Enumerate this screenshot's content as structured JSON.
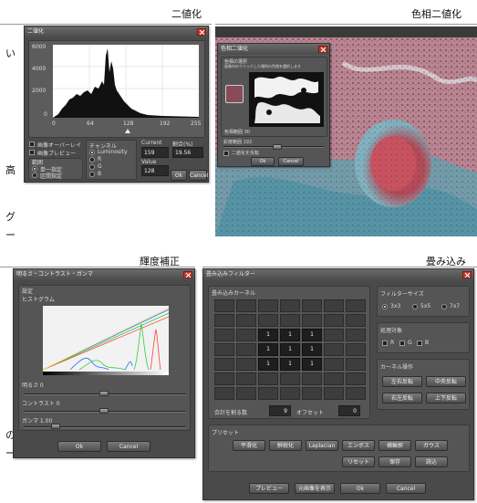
{
  "headings": {
    "binarize": "二値化",
    "hue_binarize": "色相二値化",
    "brightness": "輝度補正",
    "convolution": "畳み込み"
  },
  "side_fragments": [
    "い",
    "高",
    "グ",
    "ー",
    "の",
    "ー"
  ],
  "binarize": {
    "title": "二値化",
    "y_ticks": [
      "6000",
      "4000",
      "2000",
      "0"
    ],
    "x_ticks": [
      "0",
      "64",
      "128",
      "192",
      "255"
    ],
    "overlay_label": "画像オーバーレイ",
    "preview_label": "画像プレビュー",
    "region_label": "範囲",
    "region_options": [
      "単一指定",
      "区間指定"
    ],
    "channel_label": "チャンネル",
    "channel_options": [
      "Luminosity",
      "R",
      "G",
      "B"
    ],
    "current_label": "Current",
    "ratio_label": "割合(%)",
    "current_value": "159",
    "ratio_value": "19.56",
    "value_label": "Value",
    "value": "128",
    "ok": "Ok",
    "cancel": "Cancel"
  },
  "hue": {
    "title": "色相二値化",
    "inner_label_1": "色相の選択",
    "inner_label_2": "画像内のクリックした場所の色相を選択します",
    "tolerance_label": "色相範囲 30",
    "hue_range_label": "彩度範囲 192",
    "invert_label": "二値化を反転",
    "ok": "Ok",
    "cancel": "Cancel",
    "swatch_color": "#8a4a5a"
  },
  "brightness": {
    "title": "明るさ・コントラスト・ガンマ",
    "settings_label": "設定",
    "histogram_label": "ヒストグラム",
    "brightness_label": "明るさ 0",
    "contrast_label": "コントラスト 0",
    "gamma_label": "ガンマ 1.00",
    "ok": "Ok",
    "cancel": "Cancel",
    "curve_colors": [
      "#2c6bff",
      "#2ecc40",
      "#ff4136",
      "#f5e663"
    ]
  },
  "conv": {
    "title": "畳み込みフィルター",
    "kernel_label": "畳み込みカーネル",
    "kernel_values": [
      "1",
      "1",
      "1",
      "1",
      "1",
      "1",
      "1",
      "1",
      "1"
    ],
    "divisor_label": "合計を割る数",
    "divisor_value": "9",
    "offset_label": "オフセット",
    "offset_value": "0",
    "filter_size_label": "フィルターサイズ",
    "size_options": [
      "3x3",
      "5x5",
      "7x7"
    ],
    "target_label": "処理対象",
    "target_options": [
      "R",
      "G",
      "B"
    ],
    "kernel_ops_label": "カーネル操作",
    "kernel_ops": [
      "左右反転",
      "中央反転",
      "右左反転",
      "上下反転"
    ],
    "preset_label": "プリセット",
    "presets_row1": [
      "平滑化",
      "鮮鋭化",
      "Laplacian",
      "エンボス",
      "横輪郭",
      "ガウス"
    ],
    "presets_row2": [
      "リセット",
      "保存",
      "読込"
    ],
    "preview_btn": "プレビュー",
    "show_original_btn": "元画像を表示",
    "ok": "Ok",
    "cancel": "Cancel"
  }
}
